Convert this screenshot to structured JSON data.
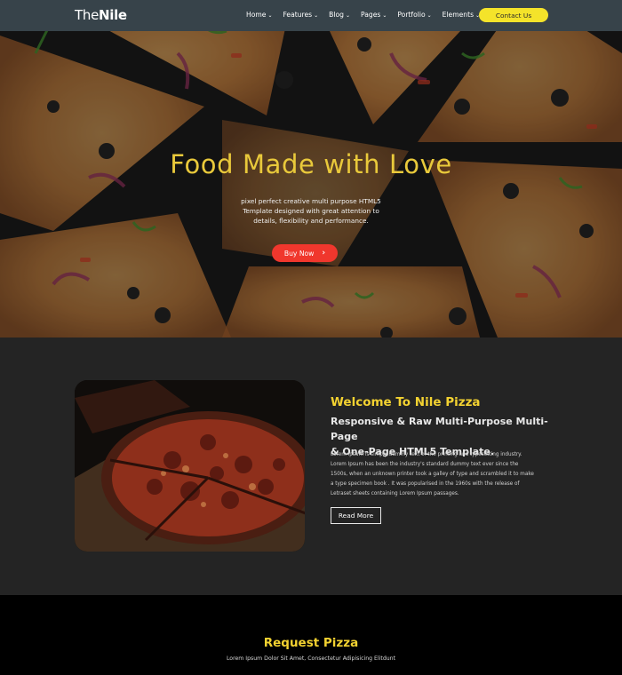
{
  "header": {
    "logo_light": "The",
    "logo_bold": "Nile",
    "nav": [
      {
        "label": "Home"
      },
      {
        "label": "Features"
      },
      {
        "label": "Blog"
      },
      {
        "label": "Pages"
      },
      {
        "label": "Portfolio"
      },
      {
        "label": "Elements"
      }
    ],
    "chevron": "⌄",
    "contact_label": "Contact Us"
  },
  "hero": {
    "title": "Food Made with Love",
    "subtitle_lines": [
      "pixel perfect creative multi purpose HTML5",
      "Template designed with great attention to",
      "details, flexibility and performance."
    ],
    "button_label": "Buy Now",
    "button_icon": "›"
  },
  "about": {
    "title": "Welcome To Nile Pizza",
    "subtitle_lines": [
      "Responsive & Raw Multi-Purpose Multi-Page",
      "& One-Page HTML5 Template."
    ],
    "body_lines": [
      "Lorem Ipsum is simply dummy text of the printing and typesetting industry.",
      "Lorem Ipsum has been the industry's standard dummy text ever since the",
      "1500s, when an unknown printer took a galley of type and scrambled it to make",
      "a type specimen book . It was popularised in the 1960s with the release of",
      "Letraset sheets containing Lorem Ipsum passages."
    ],
    "button_label": "Read More"
  },
  "request": {
    "title": "Request Pizza",
    "subtitle": "Lorem Ipsum Dolor Sit Amet, Consectetur Adipisicing Elitdunt"
  },
  "colors": {
    "navbar": "#37434a",
    "accent_yellow": "#f4e32a",
    "title_yellow": "#e9c93b",
    "buy_red": "#f0372d",
    "about_bg": "#242424"
  },
  "icons": {
    "nav_chevron": "chevron-down-icon",
    "buy_arrow": "chevron-right-icon"
  }
}
